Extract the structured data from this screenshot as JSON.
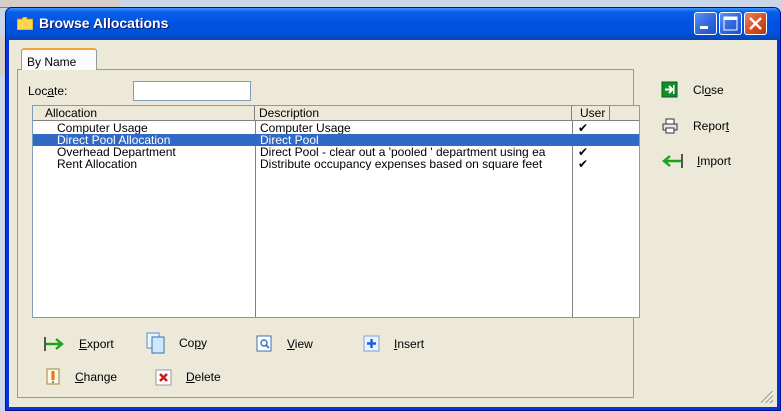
{
  "window": {
    "title": "Browse Allocations"
  },
  "tabs": [
    {
      "label": "By Name"
    }
  ],
  "locate": {
    "label": "Locate:",
    "value": ""
  },
  "grid": {
    "columns": [
      "Allocation",
      "Description",
      "User"
    ],
    "rows": [
      {
        "allocation": "Computer Usage",
        "description": "Computer Usage",
        "user": "✔",
        "selected": false
      },
      {
        "allocation": "Direct Pool Allocation",
        "description": "Direct Pool",
        "user": "",
        "selected": true
      },
      {
        "allocation": "Overhead Department",
        "description": "Direct Pool - clear out a 'pooled ' department using ea",
        "user": "✔",
        "selected": false
      },
      {
        "allocation": "Rent Allocation",
        "description": "Distribute occupancy expenses based on square feet",
        "user": "✔",
        "selected": false
      }
    ]
  },
  "bottom_buttons": {
    "export": "Export",
    "copy": "Copy",
    "view": "View",
    "insert": "Insert",
    "change": "Change",
    "delete": "Delete"
  },
  "side_buttons": {
    "close": "Close",
    "report": "Report",
    "import": "Import"
  },
  "colors": {
    "titlebar": "#0054e3",
    "selection": "#316ac5",
    "window_bg": "#ece9d8"
  }
}
